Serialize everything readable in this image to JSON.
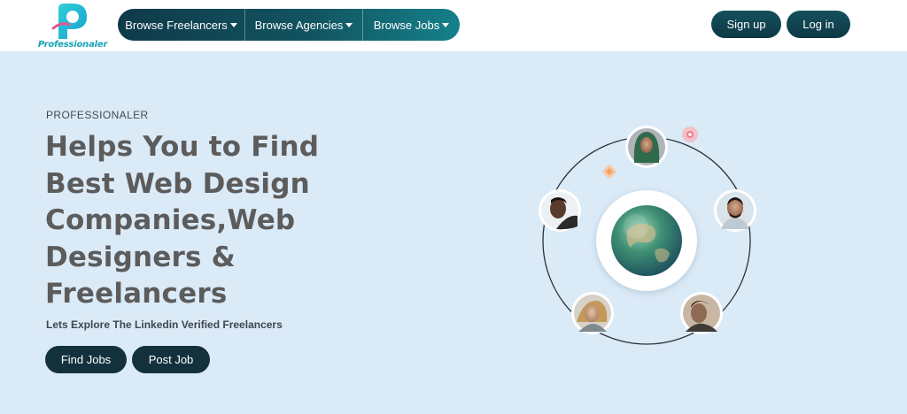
{
  "brand": {
    "name": "Professionaler",
    "colors": {
      "accent": "#1aa4b8",
      "dark": "#13313d",
      "hero_bg": "#dbeaf7"
    }
  },
  "nav": {
    "items": [
      {
        "label": "Browse Freelancers",
        "icon": "caret-down-icon"
      },
      {
        "label": "Browse Agencies",
        "icon": "caret-down-icon"
      },
      {
        "label": "Browse Jobs",
        "icon": "caret-down-icon"
      }
    ],
    "signup_label": "Sign up",
    "login_label": "Log in"
  },
  "hero": {
    "eyebrow": "PROFESSIONALER",
    "headline_lines": [
      "Helps You to Find",
      "Best Web Design",
      "Companies,Web",
      "Designers &",
      "Freelancers"
    ],
    "subline": "Lets Explore The Linkedin Verified Freelancers",
    "find_jobs_label": "Find Jobs",
    "post_job_label": "Post Job"
  },
  "illustration": {
    "center": "globe-icon",
    "avatars": [
      "avatar-hijab-woman",
      "avatar-man-left",
      "avatar-man-right",
      "avatar-woman-bottom-left",
      "avatar-man-bottom-right"
    ]
  }
}
